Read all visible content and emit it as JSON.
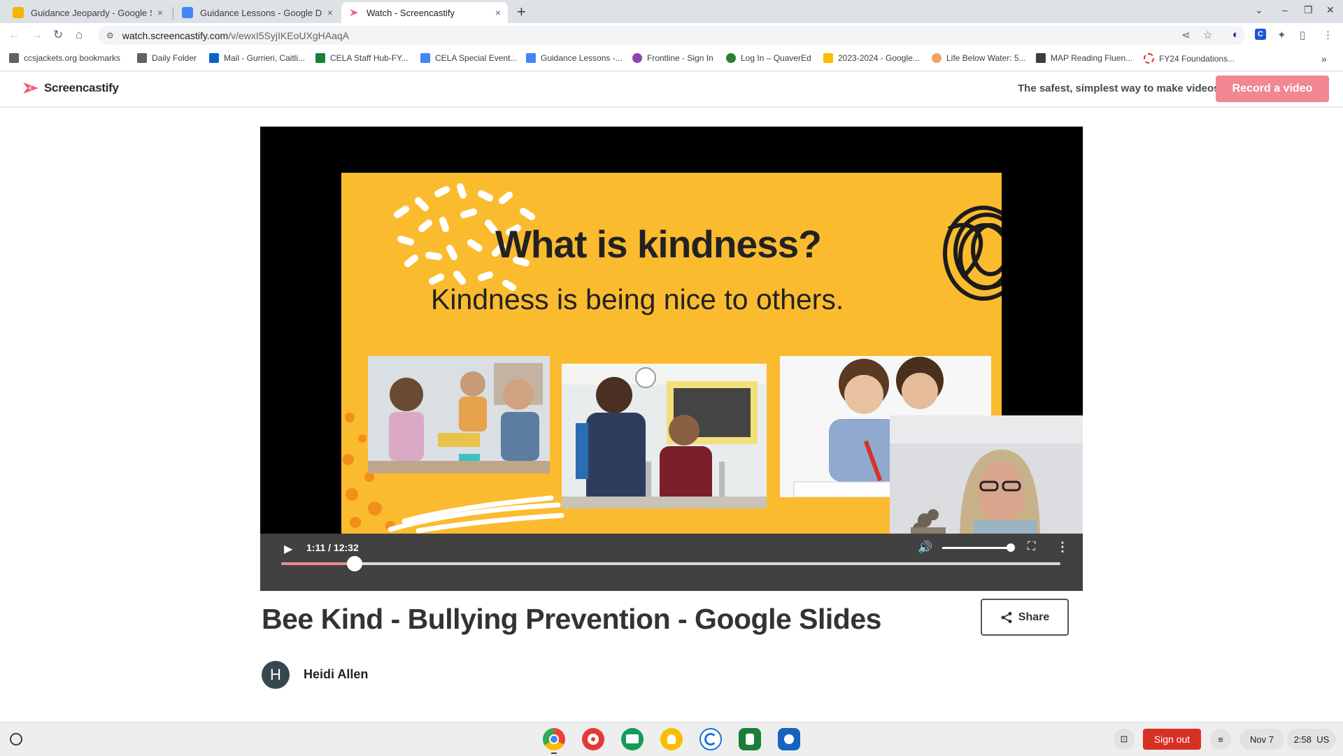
{
  "tabs": [
    {
      "title": "Guidance Jeopardy - Google Slid",
      "close": "×",
      "color": "#f4b400"
    },
    {
      "title": "Guidance Lessons - Google Docs",
      "close": "×",
      "color": "#4285f4"
    },
    {
      "title": "Watch - Screencastify",
      "close": "×",
      "color": "#ef5a7a"
    }
  ],
  "new_tab": "+",
  "window_controls": {
    "dropdown": "⌄",
    "minimize": "–",
    "restore": "❐",
    "close": "✕"
  },
  "nav": {
    "back": "←",
    "forward": "→",
    "reload": "↻",
    "home": "⌂"
  },
  "address": {
    "host": "watch.screencastify.com",
    "path": "/v/ewxI5SyjIKEoUXgHAaqA",
    "site_info_icon": "⚙"
  },
  "toolbar_icons": {
    "share": "⋖",
    "star": "☆",
    "ext1": "◐",
    "ext2": "C",
    "extensions": "✦",
    "sidebar": "▯",
    "menu": "⋮"
  },
  "bookmarks": [
    {
      "label": "ccsjackets.org bookmarks",
      "color": "#5f6368"
    },
    {
      "label": "Daily Folder",
      "color": "#5f6368"
    },
    {
      "label": "Mail - Gurrieri, Caitli...",
      "color": "#0a62c9"
    },
    {
      "label": "CELA Staff Hub-FY...",
      "color": "#188038"
    },
    {
      "label": "CELA Special Event...",
      "color": "#4285f4"
    },
    {
      "label": "Guidance Lessons -...",
      "color": "#4285f4"
    },
    {
      "label": "Frontline - Sign In",
      "color": "#8e44ad"
    },
    {
      "label": "Log In – QuaverEd",
      "color": "#2e7d32"
    },
    {
      "label": "2023-2024 - Google...",
      "color": "#fbbc04"
    },
    {
      "label": "Life Below Water: 5...",
      "color": "#f4a261"
    },
    {
      "label": "MAP Reading Fluen...",
      "color": "#3c3c3c"
    },
    {
      "label": "FY24 Foundations...",
      "color": "#d93025"
    }
  ],
  "bookmarks_more": "»",
  "header": {
    "logo_text": "Screencastify",
    "tagline": "The safest, simplest way to make videos.",
    "record_button": "Record a video",
    "brand_color": "#f08791"
  },
  "slide": {
    "title": "What is kindness?",
    "subtitle": "Kindness is being nice to others."
  },
  "player": {
    "play_icon": "▶",
    "time": "1:11 / 12:32",
    "progress": 0.094,
    "volume_icon": "🔊",
    "volume": 1.0,
    "fullscreen_icon": "⛶",
    "more_icon": "⋮"
  },
  "video": {
    "title": "Bee Kind - Bullying Prevention - Google Slides",
    "share_label": "Share",
    "share_icon": "share-icon",
    "author_initial": "H",
    "author_name": "Heidi Allen"
  },
  "shelf": {
    "apps": [
      {
        "name": "chrome"
      },
      {
        "name": "canvas-paint"
      },
      {
        "name": "classroom"
      },
      {
        "name": "keep"
      },
      {
        "name": "screencastify"
      },
      {
        "name": "pear-deck"
      },
      {
        "name": "other-app"
      }
    ],
    "screen_capture_icon": "⊡",
    "signout": "Sign out",
    "tray_icon": "≡",
    "date": "Nov 7",
    "time": "2:58",
    "locale": "US"
  }
}
